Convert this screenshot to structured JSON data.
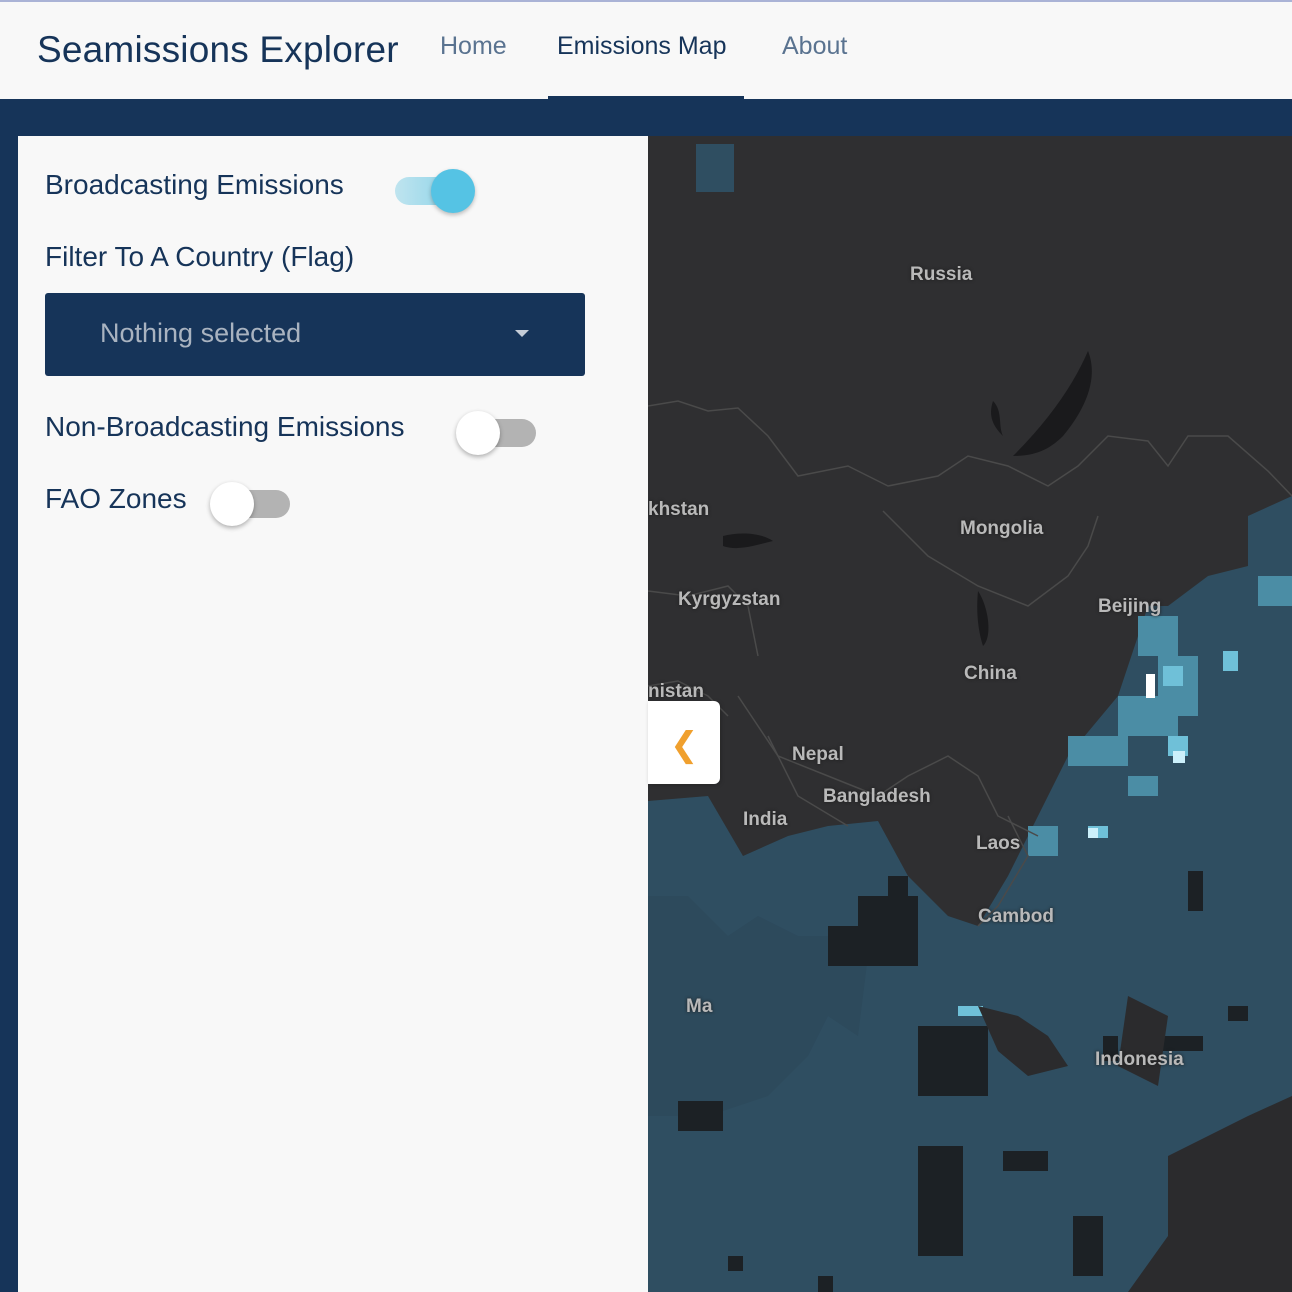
{
  "app": {
    "title": "Seamissions Explorer"
  },
  "nav": {
    "items": [
      {
        "label": "Home",
        "active": false
      },
      {
        "label": "Emissions Map",
        "active": true
      },
      {
        "label": "About",
        "active": false
      }
    ]
  },
  "sidebar": {
    "broadcasting": {
      "label": "Broadcasting Emissions",
      "enabled": true
    },
    "country_filter": {
      "label": "Filter To A Country (Flag)",
      "value": "Nothing selected"
    },
    "non_broadcasting": {
      "label": "Non-Broadcasting Emissions",
      "enabled": false
    },
    "fao_zones": {
      "label": "FAO Zones",
      "enabled": false
    }
  },
  "map": {
    "labels": {
      "russia": "Russia",
      "kazakhstan": "khstan",
      "mongolia": "Mongolia",
      "kyrgyzstan": "Kyrgyzstan",
      "beijing": "Beijing",
      "china": "China",
      "afghanistan": "nistan",
      "nepal": "Nepal",
      "bangladesh": "Bangladesh",
      "india": "India",
      "laos": "Laos",
      "cambodia": "Cambod",
      "malaysia": "Ma",
      "indonesia": "Indonesia"
    },
    "collapse_icon": "chevron-left-icon"
  },
  "colors": {
    "brand": "#163459",
    "accent": "#55c3e4",
    "land": "#2f2f31",
    "sea_emissions": "#2f4e61",
    "chevron": "#f0a02e"
  }
}
